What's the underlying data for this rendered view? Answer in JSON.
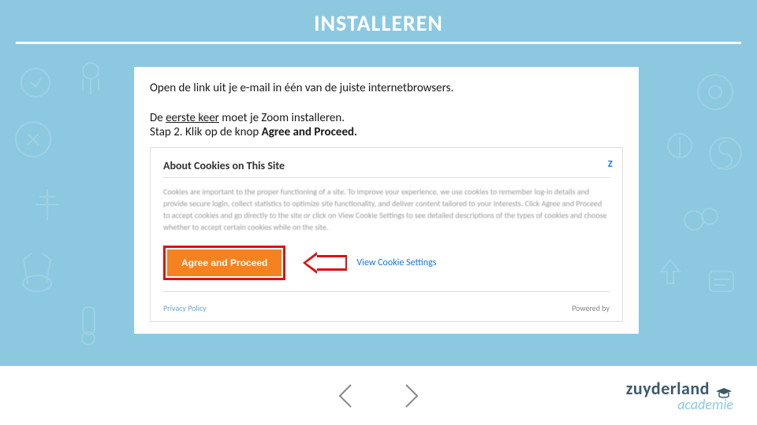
{
  "header": {
    "title": "INSTALLEREN"
  },
  "body": {
    "intro": "Open de link uit je e-mail in één van de juiste internetbrowsers.",
    "line1_pre": "De ",
    "line1_underline": "eerste keer",
    "line1_post": " moet je Zoom installeren.",
    "line2_pre": "Stap 2. Klik op de knop ",
    "line2_bold": "Agree and Proceed."
  },
  "cookie": {
    "title": "About Cookies on This Site",
    "body": "Cookies are important to the proper functioning of a site. To improve your experience, we use cookies to remember log-in details and provide secure login, collect statistics to optimize site functionality, and deliver content tailored to your interests. Click Agree and Proceed to accept cookies and go directly to the site or click on View Cookie Settings to see detailed descriptions of the types of cookies and choose whether to accept certain cookies while on the site.",
    "agree_label": "Agree and Proceed",
    "view_label": "View Cookie Settings",
    "privacy": "Privacy Policy",
    "powered": "Powered by",
    "zoom_hint": "z"
  },
  "logo": {
    "top": "zuyderland",
    "bottom": "academie"
  }
}
